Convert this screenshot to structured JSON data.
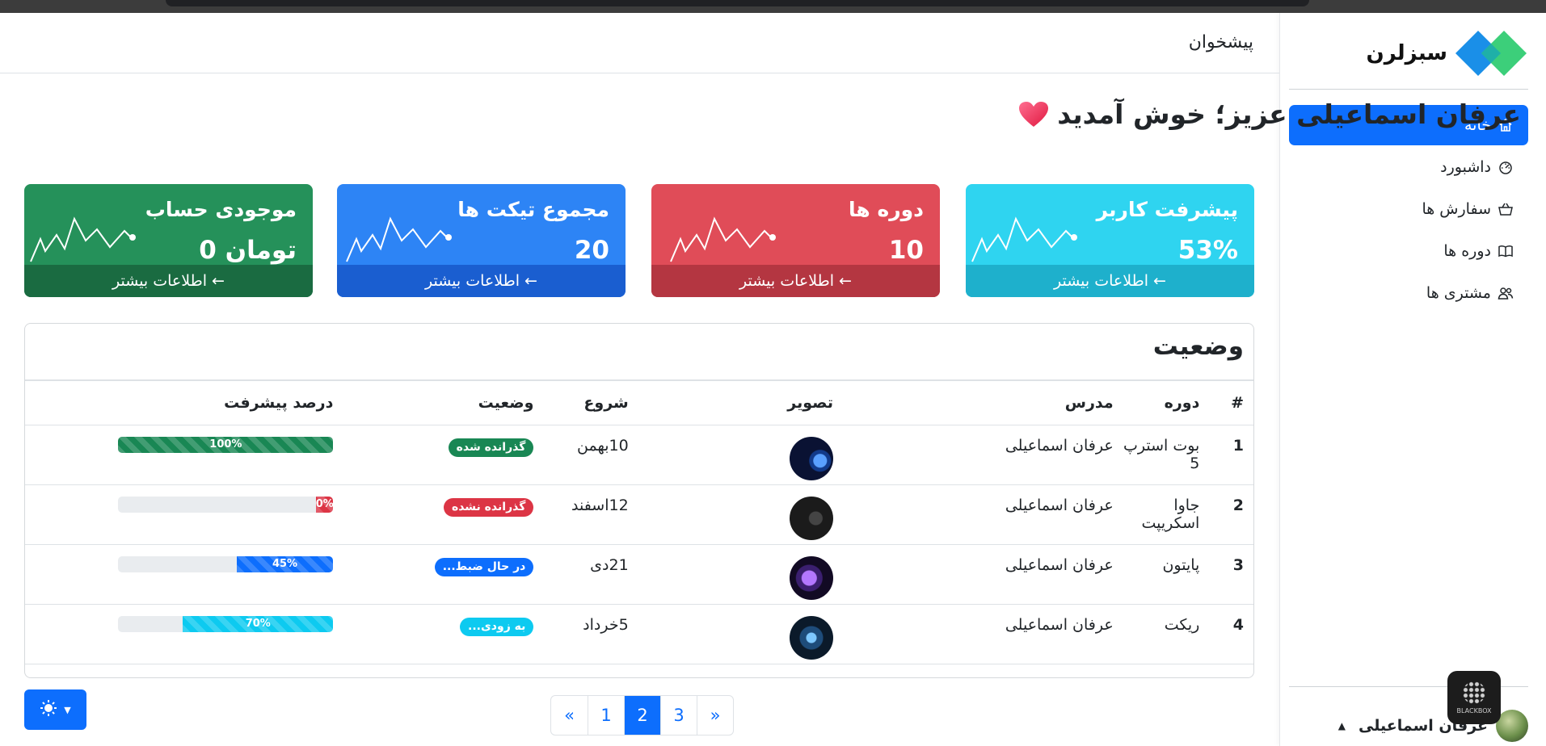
{
  "brand": {
    "name": "سبزلرن"
  },
  "sidebar": {
    "items": [
      {
        "label": "خانه",
        "icon": "home-icon",
        "active": true
      },
      {
        "label": "داشبورد",
        "icon": "speedometer-icon"
      },
      {
        "label": "سفارش ها",
        "icon": "basket-icon"
      },
      {
        "label": "دوره ها",
        "icon": "book-icon"
      },
      {
        "label": "مشتری ها",
        "icon": "people-icon"
      }
    ],
    "user_name": "عرفان اسماعیلی",
    "widget_label": "BLACKBOX"
  },
  "header": {
    "title": "پیشخوان"
  },
  "welcome": {
    "text": "عرفان اسماعیلی عزیز؛ خوش آمدید"
  },
  "cards": [
    {
      "title": "پیشرفت کاربر",
      "value": "53%",
      "link": "اطلاعات بیشتر ←"
    },
    {
      "title": "دوره ها",
      "value": "10",
      "link": "اطلاعات بیشتر ←"
    },
    {
      "title": "مجموع تیکت ها",
      "value": "20",
      "link": "اطلاعات بیشتر ←"
    },
    {
      "title": "موجودی حساب",
      "value": "0 تومان",
      "link": "اطلاعات بیشتر ←"
    }
  ],
  "status": {
    "title": "وضعیت",
    "headers": {
      "num": "#",
      "course": "دوره",
      "teacher": "مدرس",
      "image": "تصویر",
      "start": "شروع",
      "state": "وضعیت",
      "progress": "درصد پیشرفت"
    },
    "rows": [
      {
        "num": "1",
        "course": "بوت استرپ 5",
        "teacher": "عرفان اسماعیلی",
        "start": "10بهمن",
        "state": "گذرانده شده",
        "state_color": "#198754",
        "progress": 100,
        "progress_label": "100%",
        "bar_color": "#198754"
      },
      {
        "num": "2",
        "course": "جاوا اسکریپت",
        "teacher": "عرفان اسماعیلی",
        "start": "12اسفند",
        "state": "گذرانده نشده",
        "state_color": "#dc3545",
        "progress": 0,
        "progress_label": "0%",
        "bar_color": "#dc3545"
      },
      {
        "num": "3",
        "course": "پایتون",
        "teacher": "عرفان اسماعیلی",
        "start": "21دی",
        "state": "در حال ضبط...",
        "state_color": "#0d6efd",
        "progress": 45,
        "progress_label": "45%",
        "bar_color": "#0d6efd"
      },
      {
        "num": "4",
        "course": "ریکت",
        "teacher": "عرفان اسماعیلی",
        "start": "5خرداد",
        "state": "به زودی...",
        "state_color": "#0dcaf0",
        "progress": 70,
        "progress_label": "70%",
        "bar_color": "#0dcaf0"
      }
    ]
  },
  "pagination": {
    "pages": [
      "«",
      "1",
      "2",
      "3",
      "»"
    ],
    "active": "2"
  },
  "theme_toggle": {
    "icon": "sun-icon"
  }
}
